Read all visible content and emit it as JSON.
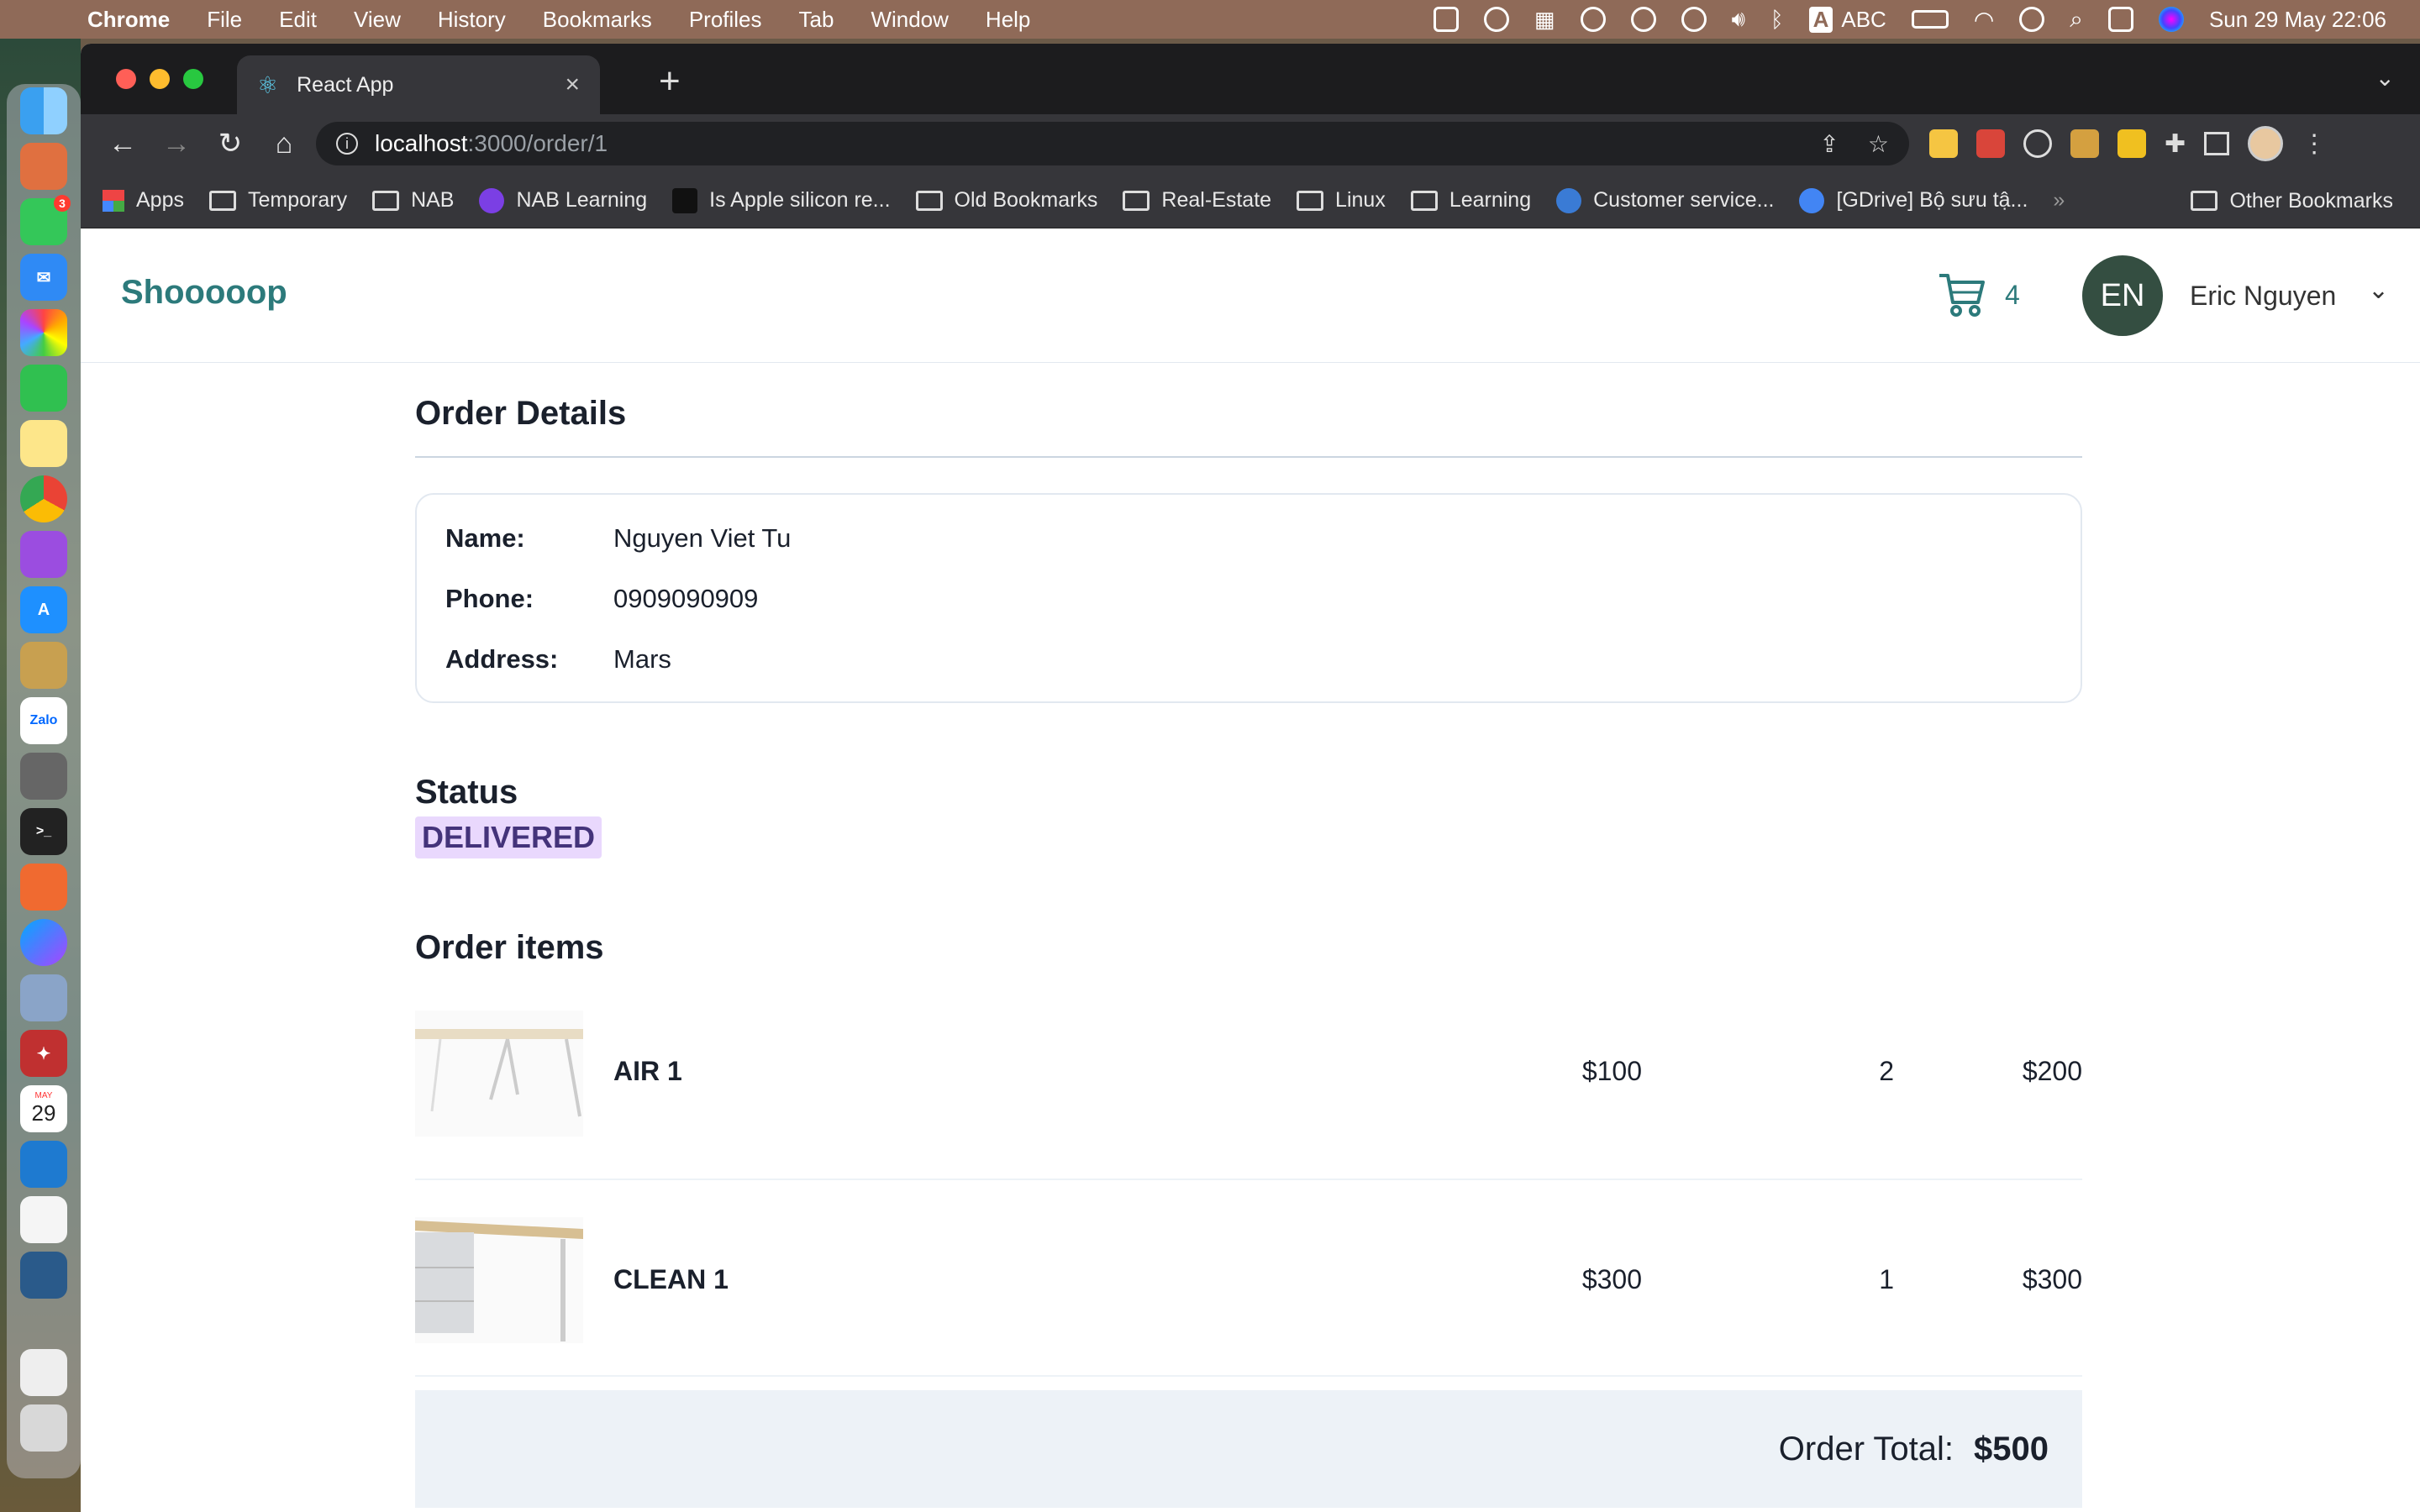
{
  "menubar": {
    "app": "Chrome",
    "items": [
      "File",
      "Edit",
      "View",
      "History",
      "Bookmarks",
      "Profiles",
      "Tab",
      "Window",
      "Help"
    ],
    "input_source": "ABC",
    "clock": "Sun 29 May  22:06"
  },
  "dock": {
    "calendar_month": "MAY",
    "calendar_day": "29",
    "messages_badge": "3",
    "zalo_label": "Zalo"
  },
  "browser": {
    "tab_title": "React App",
    "url_host": "localhost",
    "url_path": ":3000/order/1",
    "bookmarks": [
      "Apps",
      "Temporary",
      "NAB",
      "NAB Learning",
      "Is Apple silicon re...",
      "Old Bookmarks",
      "Real-Estate",
      "Linux",
      "Learning",
      "Customer service...",
      "[GDrive] Bộ sưu tậ..."
    ],
    "bookmarks_more": "»",
    "other_bookmarks": "Other Bookmarks"
  },
  "header": {
    "brand": "Shooooop",
    "cart_count": "4",
    "avatar_initials": "EN",
    "user_name": "Eric Nguyen"
  },
  "order": {
    "title": "Order Details",
    "fields": [
      {
        "label": "Name:",
        "value": "Nguyen Viet Tu"
      },
      {
        "label": "Phone:",
        "value": "0909090909"
      },
      {
        "label": "Address:",
        "value": "Mars"
      }
    ],
    "status_title": "Status",
    "status": "DELIVERED",
    "items_title": "Order items",
    "items": [
      {
        "name": "AIR 1",
        "price": "$100",
        "qty": "2",
        "total": "$200"
      },
      {
        "name": "CLEAN 1",
        "price": "$300",
        "qty": "1",
        "total": "$300"
      }
    ],
    "total_label": "Order Total:",
    "total_value": "$500"
  },
  "colors": {
    "brand": "#2c7a7b",
    "status_bg": "#e9d8fd",
    "status_text": "#44337a",
    "avatar_bg": "#344e41",
    "total_bg": "#edf2f7"
  }
}
